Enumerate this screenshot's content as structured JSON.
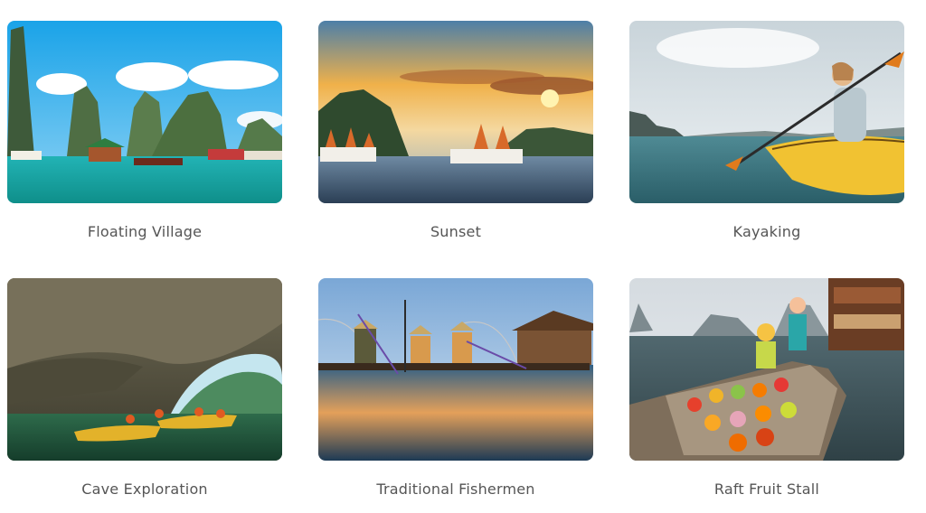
{
  "gallery": {
    "items": [
      {
        "caption": "Floating Village",
        "image": "floating-village-photo"
      },
      {
        "caption": "Sunset",
        "image": "sunset-photo"
      },
      {
        "caption": "Kayaking",
        "image": "kayaking-photo"
      },
      {
        "caption": "Cave Exploration",
        "image": "cave-exploration-photo"
      },
      {
        "caption": "Traditional Fishermen",
        "image": "traditional-fishermen-photo"
      },
      {
        "caption": "Raft Fruit Stall",
        "image": "raft-fruit-stall-photo"
      }
    ]
  }
}
